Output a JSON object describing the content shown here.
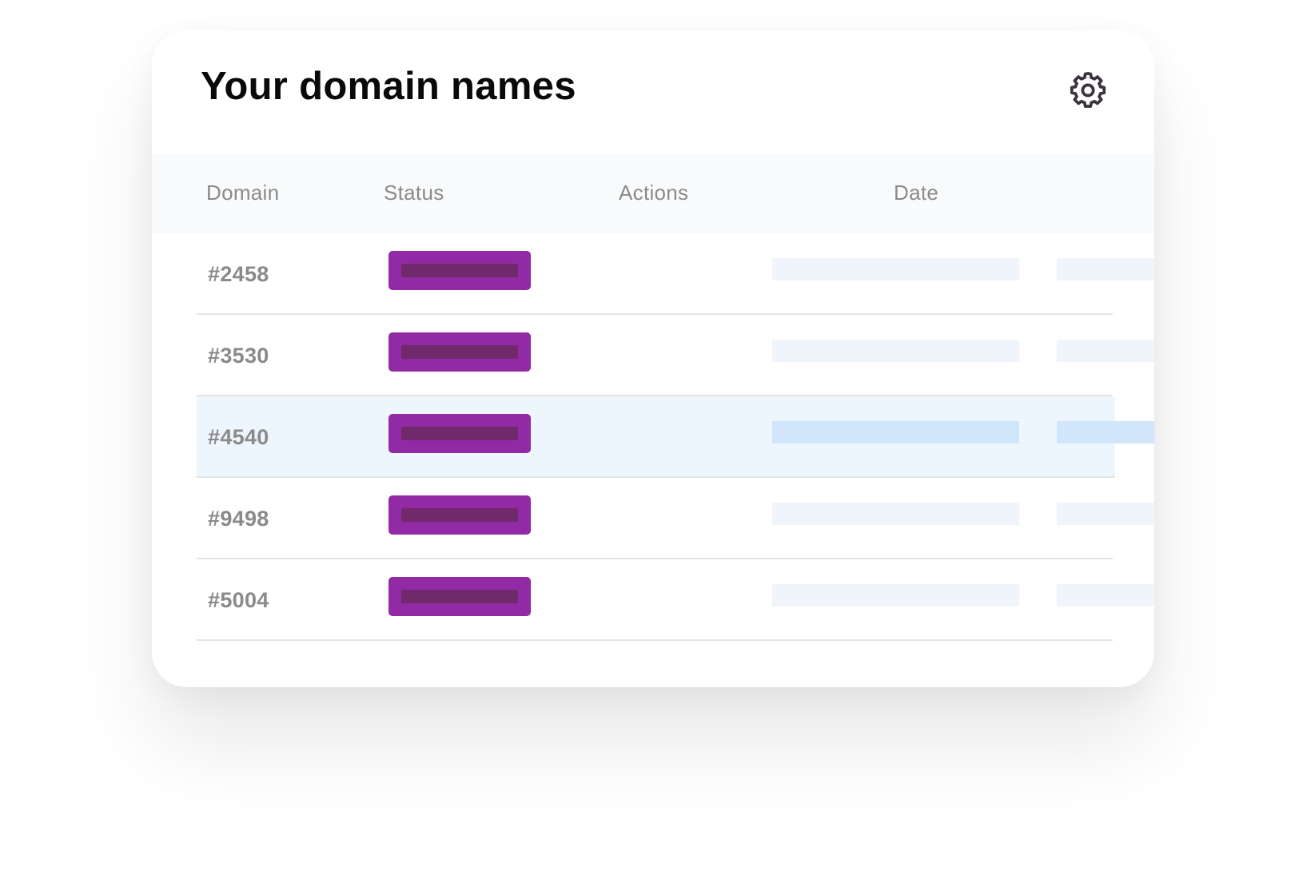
{
  "header": {
    "title": "Your domain names",
    "settings_icon": "gear-icon"
  },
  "table": {
    "columns": [
      "Domain",
      "Status",
      "Actions",
      "Date"
    ],
    "rows": [
      {
        "domain": "#2458",
        "highlighted": false
      },
      {
        "domain": "#3530",
        "highlighted": false
      },
      {
        "domain": "#4540",
        "highlighted": true
      },
      {
        "domain": "#9498",
        "highlighted": false
      },
      {
        "domain": "#5004",
        "highlighted": false
      }
    ]
  },
  "colors": {
    "status_badge": "#922aa6",
    "status_badge_inner": "#70296b",
    "placeholder": "#f0f4fb",
    "highlight_row": "#eef6fd",
    "highlight_placeholder": "#cfe6fb"
  }
}
